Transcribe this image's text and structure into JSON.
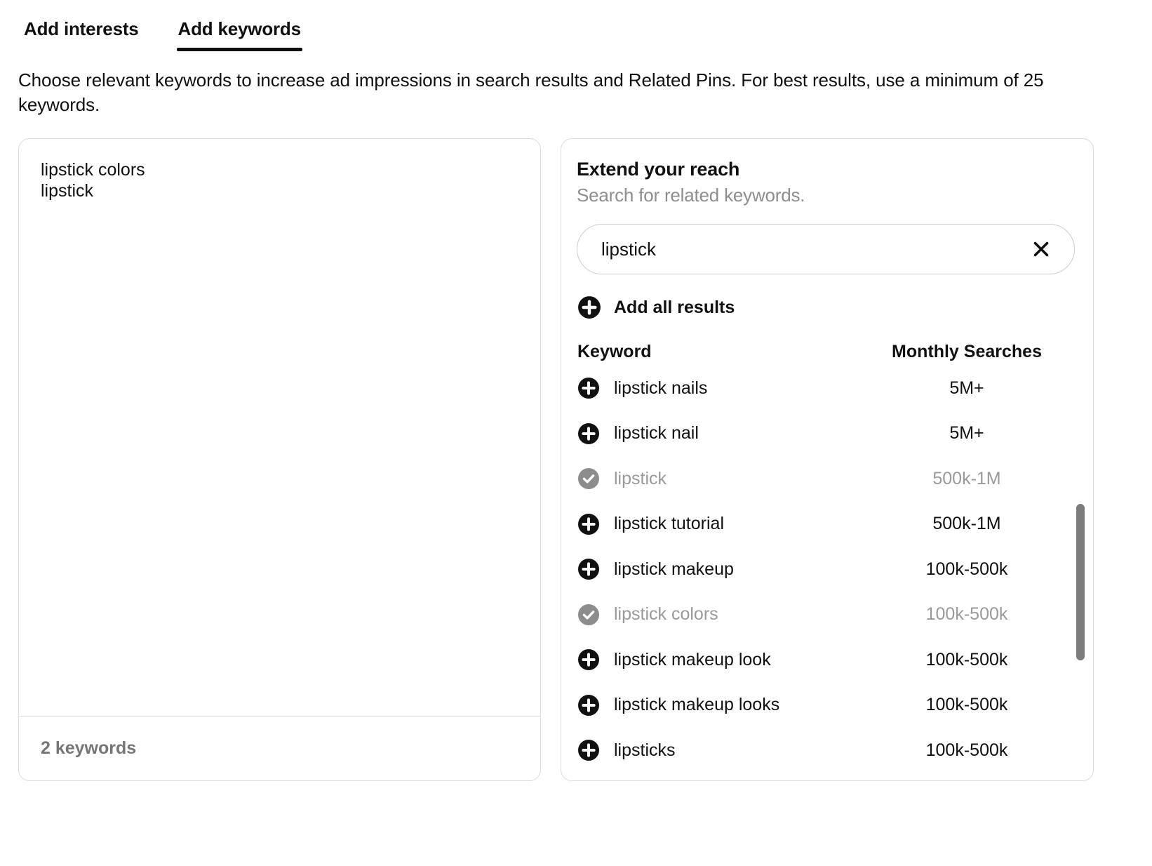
{
  "tabs": [
    {
      "label": "Add interests",
      "active": false
    },
    {
      "label": "Add keywords",
      "active": true
    }
  ],
  "description": "Choose relevant keywords to increase ad impressions in search results and Related Pins. For best results, use a minimum of 25 keywords.",
  "selected_panel": {
    "keywords": [
      "lipstick colors",
      "lipstick"
    ],
    "count_label": "2 keywords"
  },
  "extend_panel": {
    "title": "Extend your reach",
    "subtitle": "Search for related keywords.",
    "search": {
      "value": "lipstick",
      "placeholder": "Search for related keywords",
      "clear_icon": "close-icon"
    },
    "add_all_label": "Add all results",
    "add_all_icon": "plus-circle-icon",
    "columns": {
      "keyword": "Keyword",
      "monthly_searches": "Monthly Searches"
    },
    "rows": [
      {
        "keyword": "lipstick nails",
        "searches": "5M+",
        "state": "add",
        "icon": "plus-circle-icon"
      },
      {
        "keyword": "lipstick nail",
        "searches": "5M+",
        "state": "add",
        "icon": "plus-circle-icon"
      },
      {
        "keyword": "lipstick",
        "searches": "500k-1M",
        "state": "added",
        "icon": "check-circle-icon"
      },
      {
        "keyword": "lipstick tutorial",
        "searches": "500k-1M",
        "state": "add",
        "icon": "plus-circle-icon"
      },
      {
        "keyword": "lipstick makeup",
        "searches": "100k-500k",
        "state": "add",
        "icon": "plus-circle-icon"
      },
      {
        "keyword": "lipstick colors",
        "searches": "100k-500k",
        "state": "added",
        "icon": "check-circle-icon"
      },
      {
        "keyword": "lipstick makeup look",
        "searches": "100k-500k",
        "state": "add",
        "icon": "plus-circle-icon"
      },
      {
        "keyword": "lipstick makeup looks",
        "searches": "100k-500k",
        "state": "add",
        "icon": "plus-circle-icon"
      },
      {
        "keyword": "lipsticks",
        "searches": "100k-500k",
        "state": "add",
        "icon": "plus-circle-icon"
      }
    ],
    "scrollbar": {
      "name": "results-scrollbar"
    }
  },
  "colors": {
    "text": "#111111",
    "muted": "#9a9a9a",
    "subtitle": "#8e8e8e",
    "border": "#dcdcdc",
    "scrollbar": "#7b7b7b"
  }
}
